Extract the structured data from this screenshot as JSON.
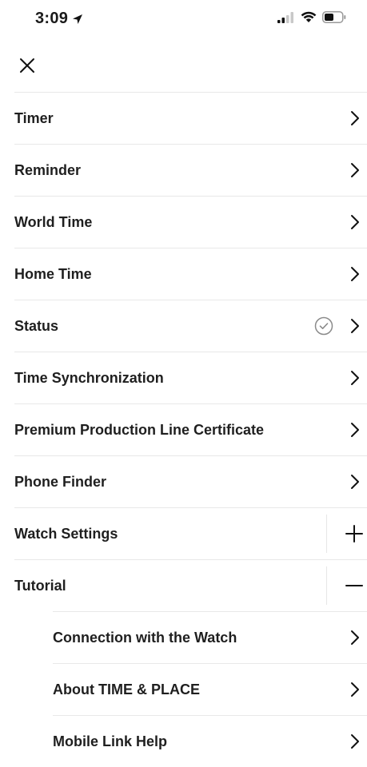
{
  "status_bar": {
    "time": "3:09"
  },
  "menu": {
    "items": [
      {
        "label": "Timer"
      },
      {
        "label": "Reminder"
      },
      {
        "label": "World Time"
      },
      {
        "label": "Home Time"
      },
      {
        "label": "Status"
      },
      {
        "label": "Time Synchronization"
      },
      {
        "label": "Premium Production Line Certificate"
      },
      {
        "label": "Phone Finder"
      },
      {
        "label": "Watch Settings"
      },
      {
        "label": "Tutorial"
      }
    ],
    "sub_items": [
      {
        "label": "Connection with the Watch"
      },
      {
        "label": "About TIME & PLACE"
      },
      {
        "label": "Mobile Link Help"
      }
    ]
  },
  "colors": {
    "text": "#1f1f1f",
    "divider": "#e8e8e8",
    "check": "#8a8a8a"
  },
  "icons": {
    "close": "close-icon",
    "chevron": "chevron-right-icon",
    "check": "check-circle-icon",
    "expand": "plus-icon",
    "collapse": "minus-icon"
  }
}
